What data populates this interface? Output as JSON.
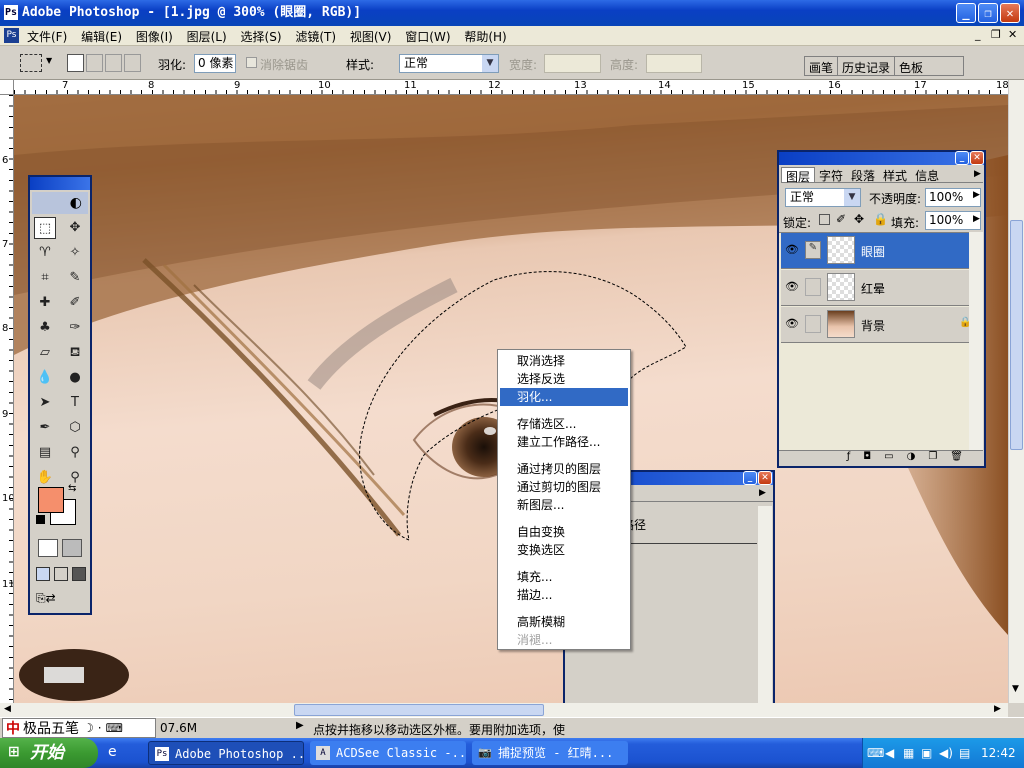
{
  "window": {
    "title": "Adobe Photoshop - [1.jpg @ 300% (眼圈, RGB)]",
    "icon": "photoshop-icon"
  },
  "menubar": {
    "items": [
      "文件(F)",
      "编辑(E)",
      "图像(I)",
      "图层(L)",
      "选择(S)",
      "滤镜(T)",
      "视图(V)",
      "窗口(W)",
      "帮助(H)"
    ]
  },
  "options": {
    "feather_label": "羽化:",
    "feather_value": "0 像素",
    "antialias_label": "消除锯齿",
    "style_label": "样式:",
    "style_value": "正常",
    "width_label": "宽度:",
    "height_label": "高度:",
    "palette_tabs": [
      "画笔",
      "历史记录",
      "色板"
    ]
  },
  "ruler": {
    "top": [
      "7",
      "8",
      "9",
      "10",
      "11",
      "12",
      "13",
      "14",
      "15",
      "16",
      "17",
      "18"
    ],
    "left": [
      "6",
      "7",
      "8",
      "9",
      "10",
      "11"
    ]
  },
  "context_menu": {
    "items": [
      "取消选择",
      "选择反选",
      "羽化...",
      "存储选区...",
      "建立工作路径...",
      "通过拷贝的图层",
      "通过剪切的图层",
      "新图层...",
      "自由变换",
      "变换选区",
      "填充...",
      "描边...",
      "高斯模糊",
      "消褪..."
    ],
    "highlighted": "羽化...",
    "disabled": [
      "消褪..."
    ]
  },
  "layers_panel": {
    "tabs": [
      "图层",
      "字符",
      "段落",
      "样式",
      "信息"
    ],
    "blend_mode": "正常",
    "opacity_label": "不透明度:",
    "opacity_value": "100%",
    "lock_label": "锁定:",
    "fill_label": "填充:",
    "fill_value": "100%",
    "layers": [
      {
        "name": "眼圈",
        "active": true
      },
      {
        "name": "红晕",
        "active": false
      },
      {
        "name": "背景",
        "active": false,
        "locked": true
      }
    ]
  },
  "paths_panel": {
    "partial_label": "路径"
  },
  "colors": {
    "foreground": "#f58f6c",
    "background": "#ffffff",
    "selection": "#316ac5"
  },
  "statusbar": {
    "ime": "极品五笔",
    "doc_size": "07.6M",
    "hint": "点按并拖移以移动选区外框。要用附加选项，使"
  },
  "taskbar": {
    "start": "开始",
    "tasks": [
      "Adobe Photoshop ...",
      "ACDSee Classic -...",
      "捕捉预览 - 红晴..."
    ],
    "clock": "12:42"
  }
}
